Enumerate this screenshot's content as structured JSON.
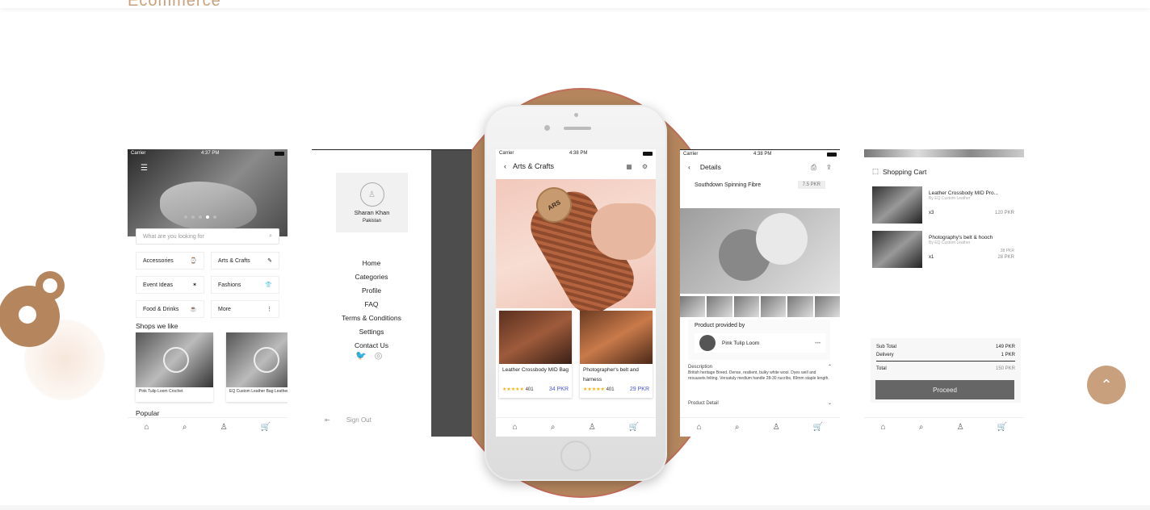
{
  "site": {
    "brand": "Ecommerce"
  },
  "screen_home": {
    "carrier": "Carrier",
    "time": "4:37 PM",
    "search_placeholder": "What are you looking for",
    "categories": [
      {
        "label": "Accessories",
        "icon": "watch-icon",
        "glyph": "⌚"
      },
      {
        "label": "Arts & Crafts",
        "icon": "craft-icon",
        "glyph": "✎"
      },
      {
        "label": "Event Ideas",
        "icon": "party-icon",
        "glyph": "✶"
      },
      {
        "label": "Fashions",
        "icon": "shirt-icon",
        "glyph": "👕"
      },
      {
        "label": "Food & Drinks",
        "icon": "food-icon",
        "glyph": "☕"
      },
      {
        "label": "More",
        "icon": "more-icon",
        "glyph": "⋮"
      }
    ],
    "shops_title": "Shops we like",
    "shops": [
      "Pink Tulip Loom Crochet",
      "EQ Custom Leather Bag Leather"
    ],
    "popular_title": "Popular"
  },
  "screen_menu": {
    "user_name": "Sharan Khan",
    "user_country": "Pakistan",
    "items": [
      "Home",
      "Categories",
      "Profile",
      "FAQ",
      "Terms & Conditions",
      "Settings",
      "Contact Us"
    ],
    "sign_out": "Sign Out"
  },
  "screen_arts": {
    "carrier": "Carrier",
    "time": "4:38 PM",
    "title": "Arts & Crafts",
    "products": [
      {
        "name": "Leather Crossbody MID Bag",
        "rating": "401",
        "price": "34 PKR"
      },
      {
        "name": "Photographer's belt and harness",
        "rating": "401",
        "price": "29 PKR"
      }
    ]
  },
  "screen_details": {
    "carrier": "Carrier",
    "time": "4:38 PM",
    "title": "Details",
    "product_name": "Southdown Spinning Fibre",
    "price": "7.5 PKR",
    "provided_by_label": "Product provided by",
    "seller": "Pink Tulip Loom",
    "description_label": "Description",
    "description": "British heritage Breed. Dense, resilient, bulky white wool. Dyes well and resuusets felting. Versatuly medium handle 28-30 nucribs, 89mm staple length.",
    "detail_label": "Product Detail"
  },
  "screen_cart": {
    "title": "Shopping Cart",
    "items": [
      {
        "name": "Leather Crossbody MID Pro...",
        "by": "By EQ Custom Leather",
        "qty": "x3",
        "amount": "120 PKR",
        "old": ""
      },
      {
        "name": "Photography's belt & hooch",
        "by": "By EQ Custom Leather",
        "qty": "x1",
        "amount": "28 PKR",
        "old": "38 PKR"
      }
    ],
    "subtotal_label": "Sub Total",
    "subtotal": "149 PKR",
    "delivery_label": "Delivery",
    "delivery": "1 PKR",
    "total_label": "Total",
    "total": "150 PKR",
    "proceed": "Proceed"
  },
  "colors": {
    "accent": "#c8a07d",
    "brown": "#b5865e",
    "price": "#4a58d8"
  }
}
